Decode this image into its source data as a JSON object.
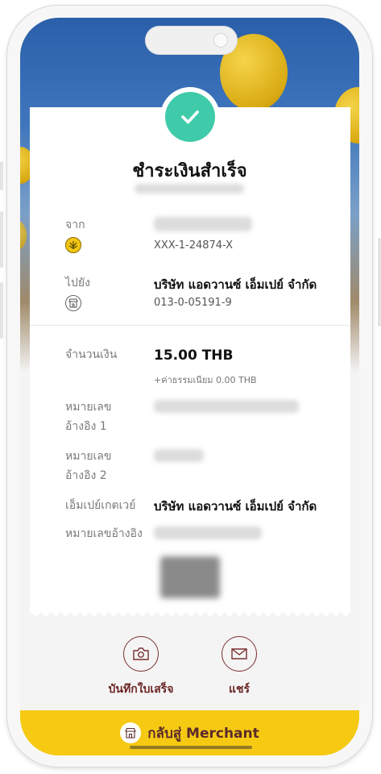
{
  "status": {
    "title": "ชำระเงินสำเร็จ"
  },
  "from": {
    "label": "จาก",
    "account": "XXX-1-24874-X"
  },
  "to": {
    "label": "ไปยัง",
    "name": "บริษัท แอดวานซ์ เอ็มเปย์ จำกัด",
    "account": "013-0-05191-9"
  },
  "amount": {
    "label": "จำนวนเงิน",
    "value": "15.00 THB",
    "fee": "+ค่าธรรมเนียม 0.00 THB"
  },
  "ref1": {
    "label_line1": "หมายเลข",
    "label_line2": "อ้างอิง 1"
  },
  "ref2": {
    "label_line1": "หมายเลข",
    "label_line2": "อ้างอิง 2"
  },
  "gateway": {
    "label": "เอ็มเปย์เกตเวย์",
    "value": "บริษัท แอดวานซ์ เอ็มเปย์ จำกัด"
  },
  "reference": {
    "label": "หมายเลขอ้างอิง"
  },
  "actions": {
    "save_label": "บันทึกใบเสร็จ",
    "share_label": "แชร์"
  },
  "footer": {
    "back_label": "กลับสู่ Merchant"
  },
  "colors": {
    "accent_green": "#3fcba9",
    "brand_yellow": "#f6c913",
    "action_maroon": "#6b2626"
  },
  "icons": {
    "success": "check-icon",
    "bank": "krungsri-bank-icon",
    "merchant": "shop-icon",
    "save": "camera-icon",
    "share": "envelope-icon",
    "home": "shop-icon"
  }
}
